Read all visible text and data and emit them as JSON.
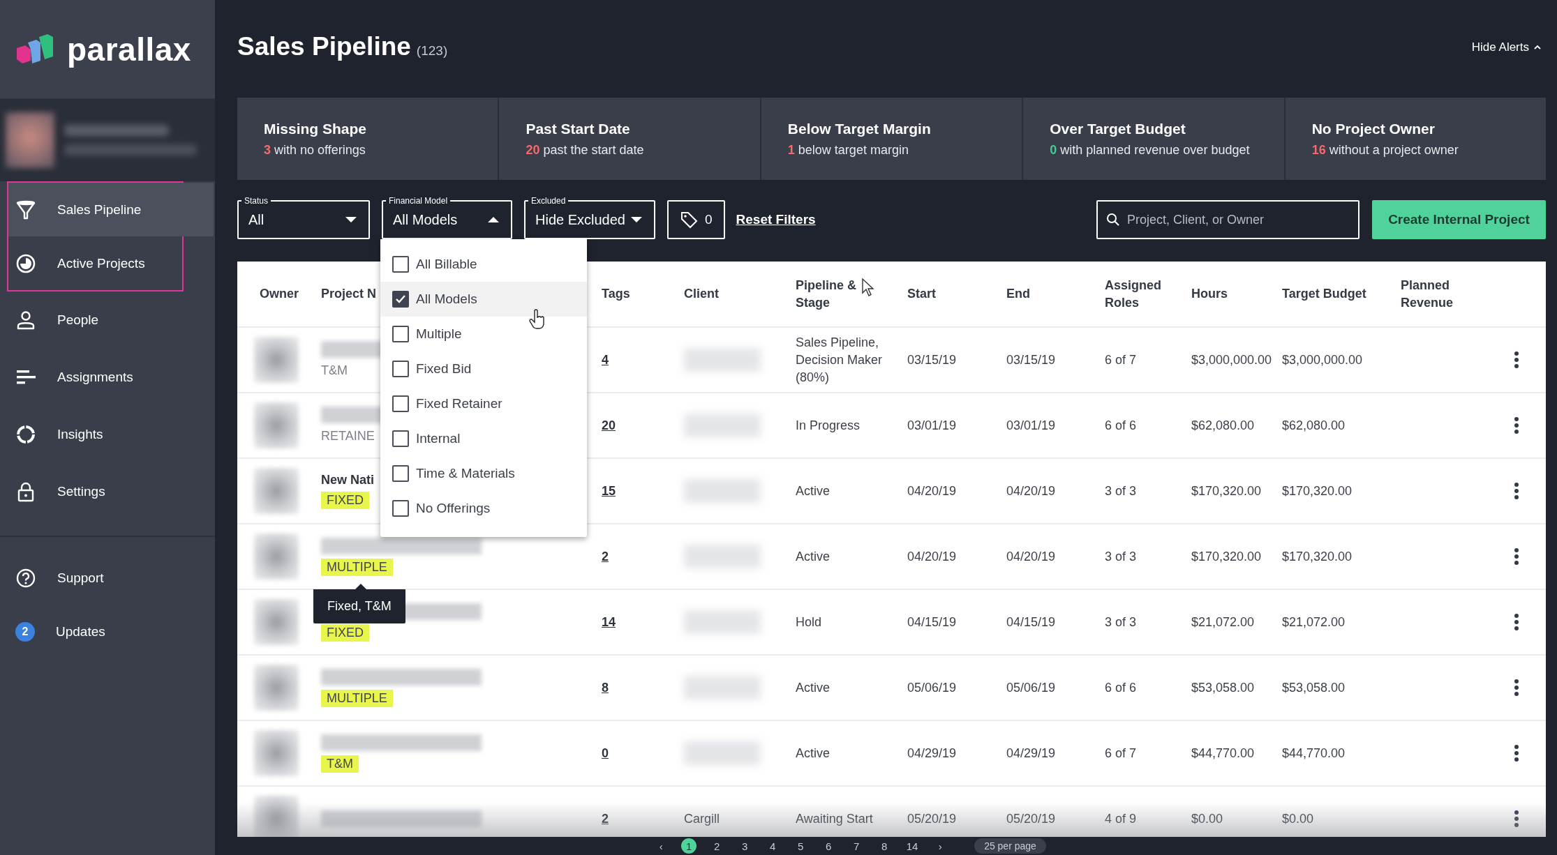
{
  "logo": {
    "text": "parallax"
  },
  "sidebar": {
    "items": [
      {
        "label": "Sales Pipeline",
        "kind": "funnel",
        "selected": true,
        "outlined": true
      },
      {
        "label": "Active Projects",
        "kind": "pie",
        "selected": false,
        "outlined": true
      },
      {
        "label": "People",
        "kind": "person",
        "selected": false,
        "outlined": false
      },
      {
        "label": "Assignments",
        "kind": "bars",
        "selected": false,
        "outlined": false
      },
      {
        "label": "Insights",
        "kind": "ring",
        "selected": false,
        "outlined": false
      },
      {
        "label": "Settings",
        "kind": "lock",
        "selected": false,
        "outlined": false
      }
    ],
    "footer_items": [
      {
        "label": "Support",
        "kind": "help"
      },
      {
        "label": "Updates",
        "kind": "badge",
        "badge": "2"
      }
    ]
  },
  "page": {
    "title": "Sales Pipeline",
    "count": "(123)",
    "hide_alerts": "Hide Alerts"
  },
  "alerts": [
    {
      "title": "Missing Shape",
      "count": "3",
      "text": "with no offerings",
      "color": "#f26b6b"
    },
    {
      "title": "Past Start Date",
      "count": "20",
      "text": "past the start date",
      "color": "#f26b6b"
    },
    {
      "title": "Below Target Margin",
      "count": "1",
      "text": "below target margin",
      "color": "#f26b6b"
    },
    {
      "title": "Over Target Budget",
      "count": "0",
      "text": "with planned revenue over budget",
      "color": "#3ecf8e"
    },
    {
      "title": "No Project Owner",
      "count": "16",
      "text": "without a project owner",
      "color": "#f26b6b"
    }
  ],
  "filters": {
    "selects": [
      {
        "label": "Status",
        "value": "All",
        "expanded": false
      },
      {
        "label": "Financial Model",
        "value": "All Models",
        "expanded": true
      },
      {
        "label": "Excluded",
        "value": "Hide Excluded",
        "expanded": false
      }
    ],
    "tag_count": "0",
    "reset": "Reset Filters",
    "search": {
      "placeholder": "Project, Client, or Owner"
    },
    "create_button": "Create Internal Project"
  },
  "model_menu": {
    "options": [
      {
        "label": "All Billable",
        "checked": false,
        "hovered": false
      },
      {
        "label": "All Models",
        "checked": true,
        "hovered": true
      },
      {
        "label": "Multiple",
        "checked": false,
        "hovered": false
      },
      {
        "label": "Fixed Bid",
        "checked": false,
        "hovered": false
      },
      {
        "label": "Fixed Retainer",
        "checked": false,
        "hovered": false
      },
      {
        "label": "Internal",
        "checked": false,
        "hovered": false
      },
      {
        "label": "Time & Materials",
        "checked": false,
        "hovered": false
      },
      {
        "label": "No Offerings",
        "checked": false,
        "hovered": false
      }
    ]
  },
  "table": {
    "columns": [
      "Owner",
      "Project N",
      "Tags",
      "Client",
      "Pipeline & Stage",
      "Start",
      "End",
      "Assigned Roles",
      "Hours",
      "Target Budget",
      "Planned Revenue"
    ],
    "rows": [
      {
        "model": "T&M",
        "model_highlighted": false,
        "tags": "4",
        "stage": "Sales Pipeline, Decision Maker (80%)",
        "start": "03/15/19",
        "end": "03/15/19",
        "roles": "6 of 7",
        "hours": "$3,000,000.00",
        "target_budget": "$3,000,000.00"
      },
      {
        "model": "RETAINE",
        "model_highlighted": false,
        "tags": "20",
        "stage": "In Progress",
        "start": "03/01/19",
        "end": "03/01/19",
        "roles": "6 of 6",
        "hours": "$62,080.00",
        "target_budget": "$62,080.00"
      },
      {
        "project_name": "New Nati",
        "model": "FIXED",
        "model_highlighted": true,
        "tags": "15",
        "stage": "Active",
        "start": "04/20/19",
        "end": "04/20/19",
        "roles": "3 of 3",
        "hours": "$170,320.00",
        "target_budget": "$170,320.00"
      },
      {
        "model": "MULTIPLE",
        "model_highlighted": true,
        "tags": "2",
        "stage": "Active",
        "start": "04/20/19",
        "end": "04/20/19",
        "roles": "3 of 3",
        "hours": "$170,320.00",
        "target_budget": "$170,320.00"
      },
      {
        "model": "FIXED",
        "model_highlighted": true,
        "tags": "14",
        "stage": "Hold",
        "start": "04/15/19",
        "end": "04/15/19",
        "roles": "3 of 3",
        "hours": "$21,072.00",
        "target_budget": "$21,072.00"
      },
      {
        "model": "MULTIPLE",
        "model_highlighted": true,
        "tags": "8",
        "stage": "Active",
        "start": "05/06/19",
        "end": "05/06/19",
        "roles": "6 of 6",
        "hours": "$53,058.00",
        "target_budget": "$53,058.00"
      },
      {
        "model": "T&M",
        "model_highlighted": true,
        "tags": "0",
        "stage": "Active",
        "start": "04/29/19",
        "end": "04/29/19",
        "roles": "6 of 7",
        "hours": "$44,770.00",
        "target_budget": "$44,770.00"
      },
      {
        "tags": "2",
        "client": "Cargill",
        "stage": "Awaiting Start",
        "start": "05/20/19",
        "end": "05/20/19",
        "roles": "4 of 9",
        "hours": "$0.00",
        "target_budget": "$0.00"
      }
    ]
  },
  "tooltip": {
    "text": "Fixed, T&M"
  },
  "pagination": {
    "prev": "‹",
    "pages": [
      {
        "label": "1",
        "selected": true
      },
      {
        "label": "2",
        "selected": false
      },
      {
        "label": "3",
        "selected": false
      },
      {
        "label": "4",
        "selected": false
      },
      {
        "label": "5",
        "selected": false
      },
      {
        "label": "6",
        "selected": false
      },
      {
        "label": "7",
        "selected": false
      },
      {
        "label": "8",
        "selected": false
      },
      {
        "label": "14",
        "selected": false
      }
    ],
    "next": "›",
    "per_page": "25 per page"
  }
}
